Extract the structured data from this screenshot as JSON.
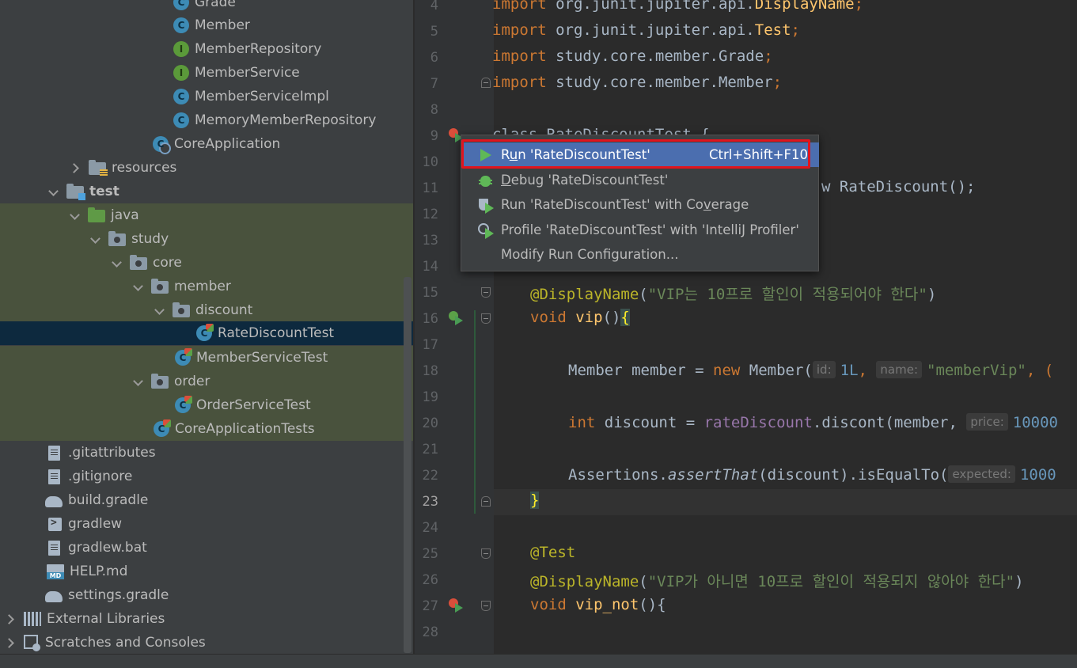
{
  "project_tree": {
    "items": [
      {
        "label": "Grade",
        "icon": "class-icon"
      },
      {
        "label": "Member",
        "icon": "class-icon"
      },
      {
        "label": "MemberRepository",
        "icon": "interface-icon"
      },
      {
        "label": "MemberService",
        "icon": "interface-icon"
      },
      {
        "label": "MemberServiceImpl",
        "icon": "class-icon"
      },
      {
        "label": "MemoryMemberRepository",
        "icon": "class-icon"
      },
      {
        "label": "CoreApplication",
        "icon": "spring-boot-class-icon"
      },
      {
        "label": "resources",
        "icon": "resources-folder-icon"
      },
      {
        "label": "test",
        "icon": "test-root-folder-icon"
      },
      {
        "label": "java",
        "icon": "test-sources-folder-icon"
      },
      {
        "label": "study",
        "icon": "package-icon"
      },
      {
        "label": "core",
        "icon": "package-icon"
      },
      {
        "label": "member",
        "icon": "package-icon"
      },
      {
        "label": "discount",
        "icon": "package-icon"
      },
      {
        "label": "RateDiscountTest",
        "icon": "test-class-icon"
      },
      {
        "label": "MemberServiceTest",
        "icon": "test-class-icon"
      },
      {
        "label": "order",
        "icon": "package-icon"
      },
      {
        "label": "OrderServiceTest",
        "icon": "test-class-icon"
      },
      {
        "label": "CoreApplicationTests",
        "icon": "test-class-icon"
      },
      {
        "label": ".gitattributes",
        "icon": "text-file-icon"
      },
      {
        "label": ".gitignore",
        "icon": "gitignore-file-icon"
      },
      {
        "label": "build.gradle",
        "icon": "gradle-icon"
      },
      {
        "label": "gradlew",
        "icon": "shell-script-icon"
      },
      {
        "label": "gradlew.bat",
        "icon": "text-file-icon"
      },
      {
        "label": "HELP.md",
        "icon": "markdown-file-icon"
      },
      {
        "label": "settings.gradle",
        "icon": "gradle-icon"
      },
      {
        "label": "External Libraries",
        "icon": "libraries-icon"
      },
      {
        "label": "Scratches and Consoles",
        "icon": "scratches-icon"
      }
    ],
    "selected": "RateDiscountTest"
  },
  "editor": {
    "line_numbers": [
      "4",
      "5",
      "6",
      "7",
      "8",
      "9",
      "10",
      "11",
      "12",
      "13",
      "14",
      "15",
      "16",
      "17",
      "18",
      "19",
      "20",
      "21",
      "22",
      "23",
      "24",
      "25",
      "26",
      "27",
      "28"
    ],
    "current_line": "23",
    "code": {
      "l4_import": "import ",
      "l4_pkg": "org.junit.jupiter.api.",
      "l4_cls": "DisplayName",
      "l5_import": "import ",
      "l5_pkg": "org.junit.jupiter.api.",
      "l5_cls": "Test",
      "l6_import": "import ",
      "l6_pkg": "study.core.member.Grade",
      "l7_import": "import ",
      "l7_pkg": "study.core.member.Member",
      "semi": ";",
      "l9_partial": "class RateDiscountTest {",
      "l11_partial": "w RateDiscount();",
      "l15_ann": "@DisplayName",
      "l15_str": "\"VIP는 10프로 할인이 적용되어야 한다\"",
      "l16_void": "void ",
      "l16_name": "vip",
      "l18_a": "Member member = ",
      "l18_new": "new ",
      "l18_b": "Member(",
      "l18_hint1": "id:",
      "l18_val1": "1L",
      "l18_comma": ", ",
      "l18_hint2": "name:",
      "l18_str": "\"memberVip\"",
      "l18_tail": ", (",
      "l20_int": "int ",
      "l20_a": "discount = ",
      "l20_field": "rateDiscount",
      "l20_b": ".discont(member, ",
      "l20_hint": "price:",
      "l20_num": "10000",
      "l22_a": "Assertions.",
      "l22_method": "assertThat",
      "l22_b": "(discount).isEqualTo(",
      "l22_hint": "expected:",
      "l22_num": "1000",
      "l23_brace": "}",
      "l25_ann": "@Test",
      "l26_ann": "@DisplayName",
      "l26_str": "\"VIP가 아니면 10프로 할인이 적용되지 않아야 한다\"",
      "l27_void": "void ",
      "l27_name": "vip_not",
      "l27_tail": "(){"
    }
  },
  "context_menu": {
    "items": [
      {
        "pre": "R",
        "u": "u",
        "post": "n 'RateDiscountTest'",
        "shortcut": "Ctrl+Shift+F10",
        "icon": "run-icon"
      },
      {
        "pre": "",
        "u": "D",
        "post": "ebug 'RateDiscountTest'",
        "shortcut": "",
        "icon": "debug-icon"
      },
      {
        "pre": "Run 'RateDiscountTest' with Co",
        "u": "v",
        "post": "erage",
        "shortcut": "",
        "icon": "coverage-icon"
      },
      {
        "pre": "Profile 'RateDiscountTest' with 'IntelliJ Profiler'",
        "u": "",
        "post": "",
        "shortcut": "",
        "icon": "profiler-icon"
      },
      {
        "pre": "Modify Run Configuration...",
        "u": "",
        "post": "",
        "shortcut": "",
        "icon": ""
      }
    ]
  },
  "colors": {
    "accent_selection": "#4b6eaf",
    "highlight_box": "#e0141e",
    "test_source_bg": "#49523d",
    "selected_row_bg": "#0d293e"
  }
}
